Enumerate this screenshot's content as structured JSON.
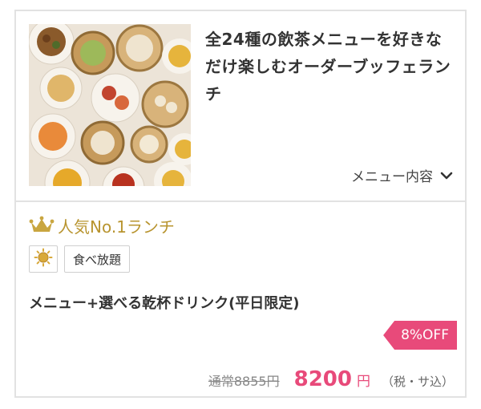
{
  "plan": {
    "headline": "全24種の飲茶メニューを好きなだけ楽しむオーダーブッフェランチ",
    "menu_toggle_label": "メニュー内容",
    "rank_label": "人気No.1ランチ",
    "tags": [
      "食べ放題"
    ],
    "title": "メニュー+選べる乾杯ドリンク(平日限定)",
    "discount_label": "8%OFF",
    "regular_price": "通常8855円",
    "price": "8200",
    "price_unit": "円",
    "tax_note": "（税・サ込）"
  },
  "icons": {
    "toggle": "chevron-down-icon",
    "rank": "crown-icon",
    "time": "sun-icon"
  },
  "colors": {
    "accent": "#e84a7a",
    "gold": "#b8942f",
    "border": "#e2e2e2"
  }
}
